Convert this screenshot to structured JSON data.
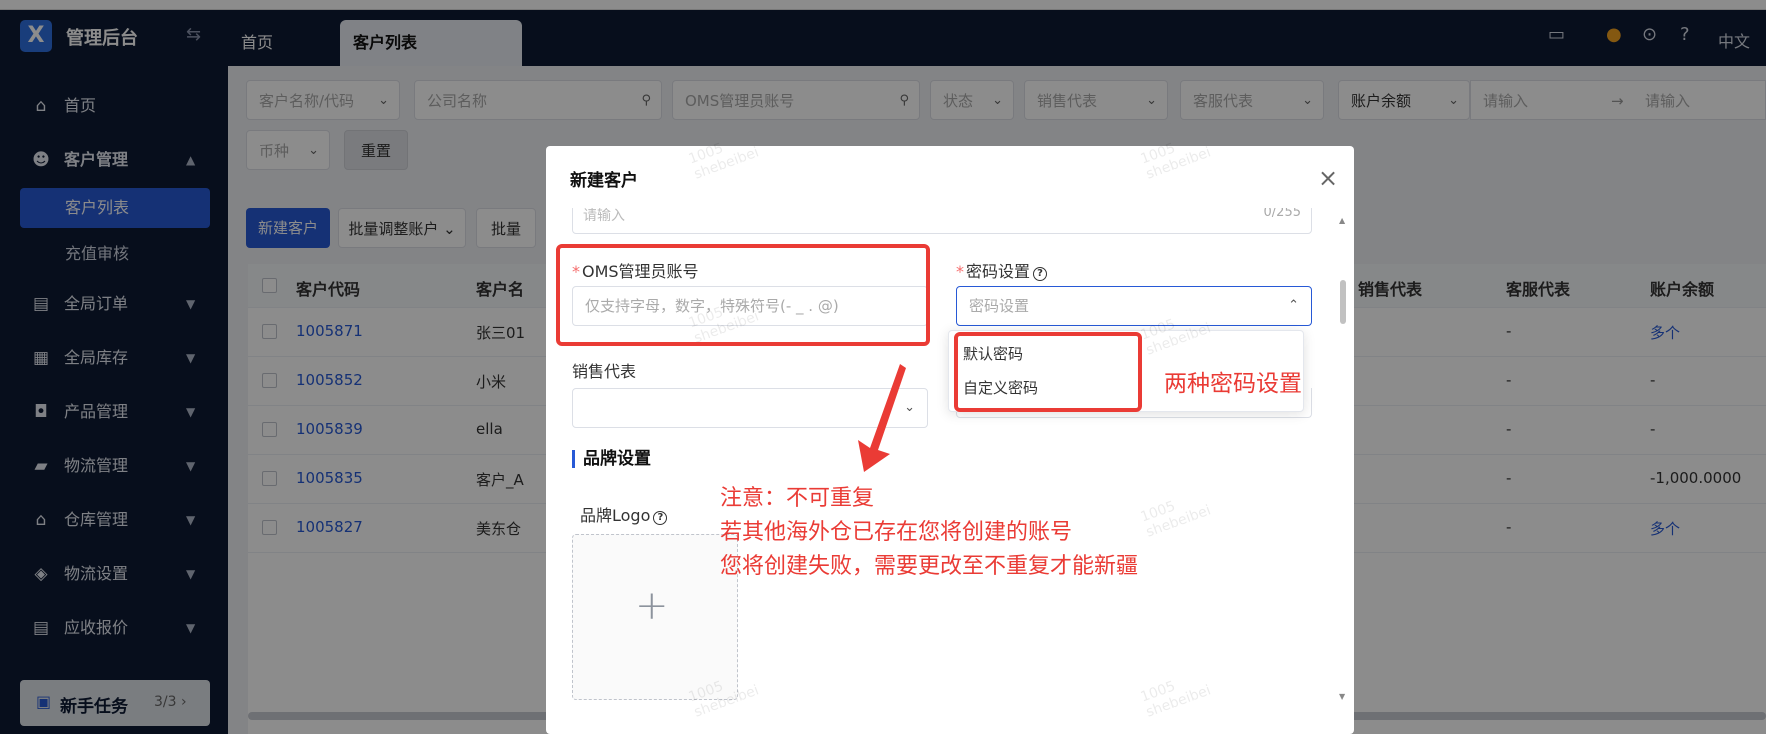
{
  "header": {
    "app_title": "管理后台",
    "tabs": [
      {
        "label": "首页"
      },
      {
        "label": "客户列表"
      }
    ],
    "language": "中文"
  },
  "sidebar": {
    "items": [
      {
        "label": "首页",
        "icon": "home-icon"
      },
      {
        "label": "客户管理",
        "icon": "users-icon"
      },
      {
        "label": "客户列表"
      },
      {
        "label": "充值审核"
      },
      {
        "label": "全局订单",
        "icon": "clipboard-icon"
      },
      {
        "label": "全局库存",
        "icon": "warehouse-icon"
      },
      {
        "label": "产品管理",
        "icon": "bag-icon"
      },
      {
        "label": "物流管理",
        "icon": "truck-icon"
      },
      {
        "label": "仓库管理",
        "icon": "house-icon"
      },
      {
        "label": "物流设置",
        "icon": "box-gear-icon"
      },
      {
        "label": "应收报价",
        "icon": "document-icon"
      }
    ],
    "task": {
      "label": "新手任务",
      "count": "3/3"
    }
  },
  "filters": {
    "customer_name_code": "客户名称/代码",
    "company_name": "公司名称",
    "oms_account": "OMS管理员账号",
    "status": "状态",
    "sales_rep": "销售代表",
    "service_rep": "客服代表",
    "balance": "账户余额",
    "range_start": "请输入",
    "range_end": "请输入",
    "currency": "币种",
    "reset": "重置"
  },
  "toolbar": {
    "new_customer": "新建客户",
    "batch_adjust": "批量调整账户",
    "batch_more": "批量"
  },
  "table": {
    "headers": [
      "客户代码",
      "客户名",
      "销售代表",
      "客服代表",
      "账户余额"
    ],
    "rows": [
      {
        "code": "1005871",
        "name": "张三01",
        "service": "-",
        "balance": "多个"
      },
      {
        "code": "1005852",
        "name": "小米",
        "service": "-",
        "balance": "-"
      },
      {
        "code": "1005839",
        "name": "ella",
        "service": "-",
        "balance": "-"
      },
      {
        "code": "1005835",
        "name": "客户_A",
        "service": "-",
        "balance": "-1,000.0000"
      },
      {
        "code": "1005827",
        "name": "美东仓",
        "service": "-",
        "balance": "多个"
      }
    ]
  },
  "modal": {
    "title": "新建客户",
    "top_input_placeholder": "请输入",
    "top_input_count": "0/255",
    "oms_label": "OMS管理员账号",
    "oms_placeholder": "仅支持字母，数字，特殊符号(- _ . @)",
    "password_label": "密码设置",
    "password_placeholder": "密码设置",
    "sales_label": "销售代表",
    "brand_section": "品牌设置",
    "brand_logo_label": "品牌Logo",
    "password_options": [
      "默认密码",
      "自定义密码"
    ]
  },
  "annotations": {
    "password_note": "两种密码设置",
    "warning_lines": [
      "注意：不可重复",
      "若其他海外仓已存在您将创建的账号",
      "您将创建失败，需要更改至不重复才能新疆"
    ],
    "color": "#ea3b35"
  },
  "watermark": {
    "line1": "1005",
    "line2": "shebeibei"
  },
  "colors": {
    "brand_blue": "#2759d6",
    "nav_bg": "#0e1a33"
  }
}
